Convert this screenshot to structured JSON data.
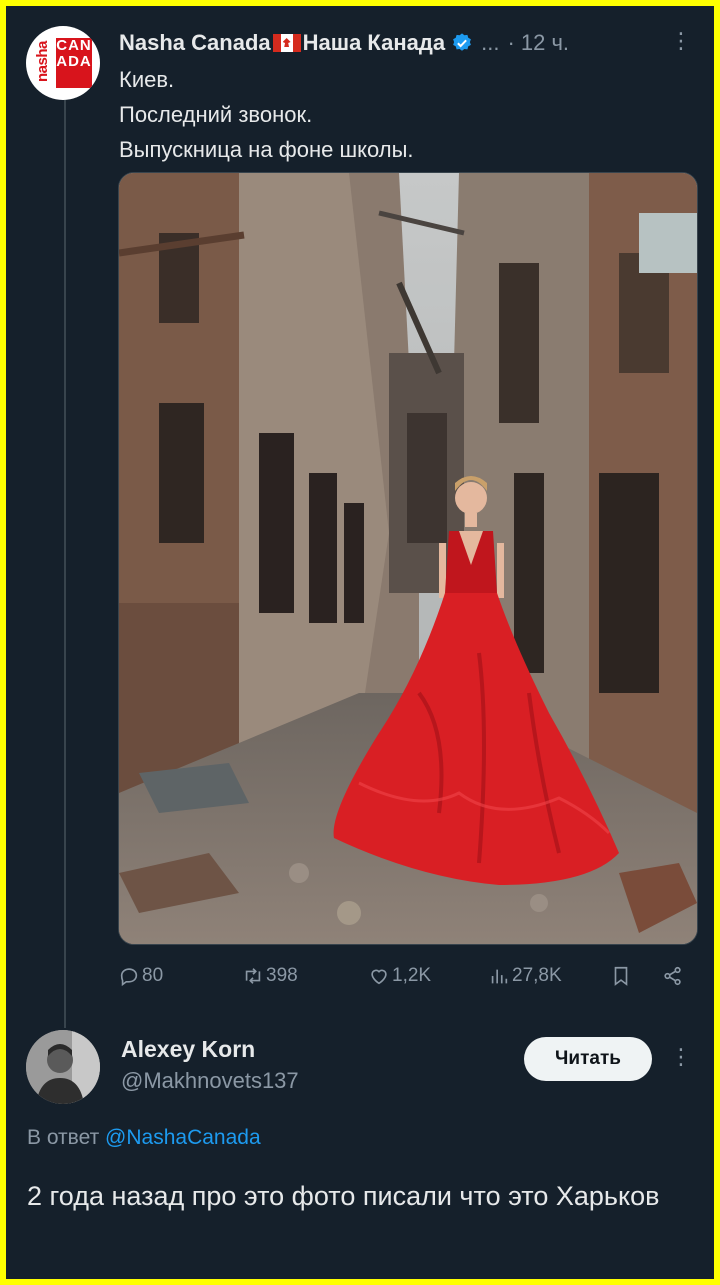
{
  "tweet": {
    "author_name": "Nasha Canada",
    "author_name_ru": "Наша Канада",
    "separator": "...",
    "time": "· 12 ч.",
    "avatar_logo": {
      "side": "nasha",
      "grid": "CANADA"
    },
    "lines": [
      "Киев.",
      "Последний звонок.",
      "Выпускница на фоне школы."
    ],
    "image_description": "Girl in a red gown standing in a bombed-out school corridor",
    "stats": {
      "replies": "80",
      "retweets": "398",
      "likes": "1,2K",
      "views": "27,8K"
    }
  },
  "reply": {
    "name": "Alexey Korn",
    "handle": "@Makhnovets137",
    "follow_label": "Читать",
    "replying_prefix": "В ответ",
    "replying_to": "@NashaCanada",
    "text": "2 года назад про это фото писали что это Харьков"
  },
  "colors": {
    "background": "#15202b",
    "frame": "#ffff00",
    "text": "#e7e9ea",
    "muted": "#8b98a5",
    "accent": "#1d9bf0",
    "dress": "#d91f24"
  },
  "icons": [
    "verified-icon",
    "more-icon",
    "reply-icon",
    "retweet-icon",
    "like-icon",
    "views-icon",
    "bookmark-icon",
    "share-icon"
  ]
}
